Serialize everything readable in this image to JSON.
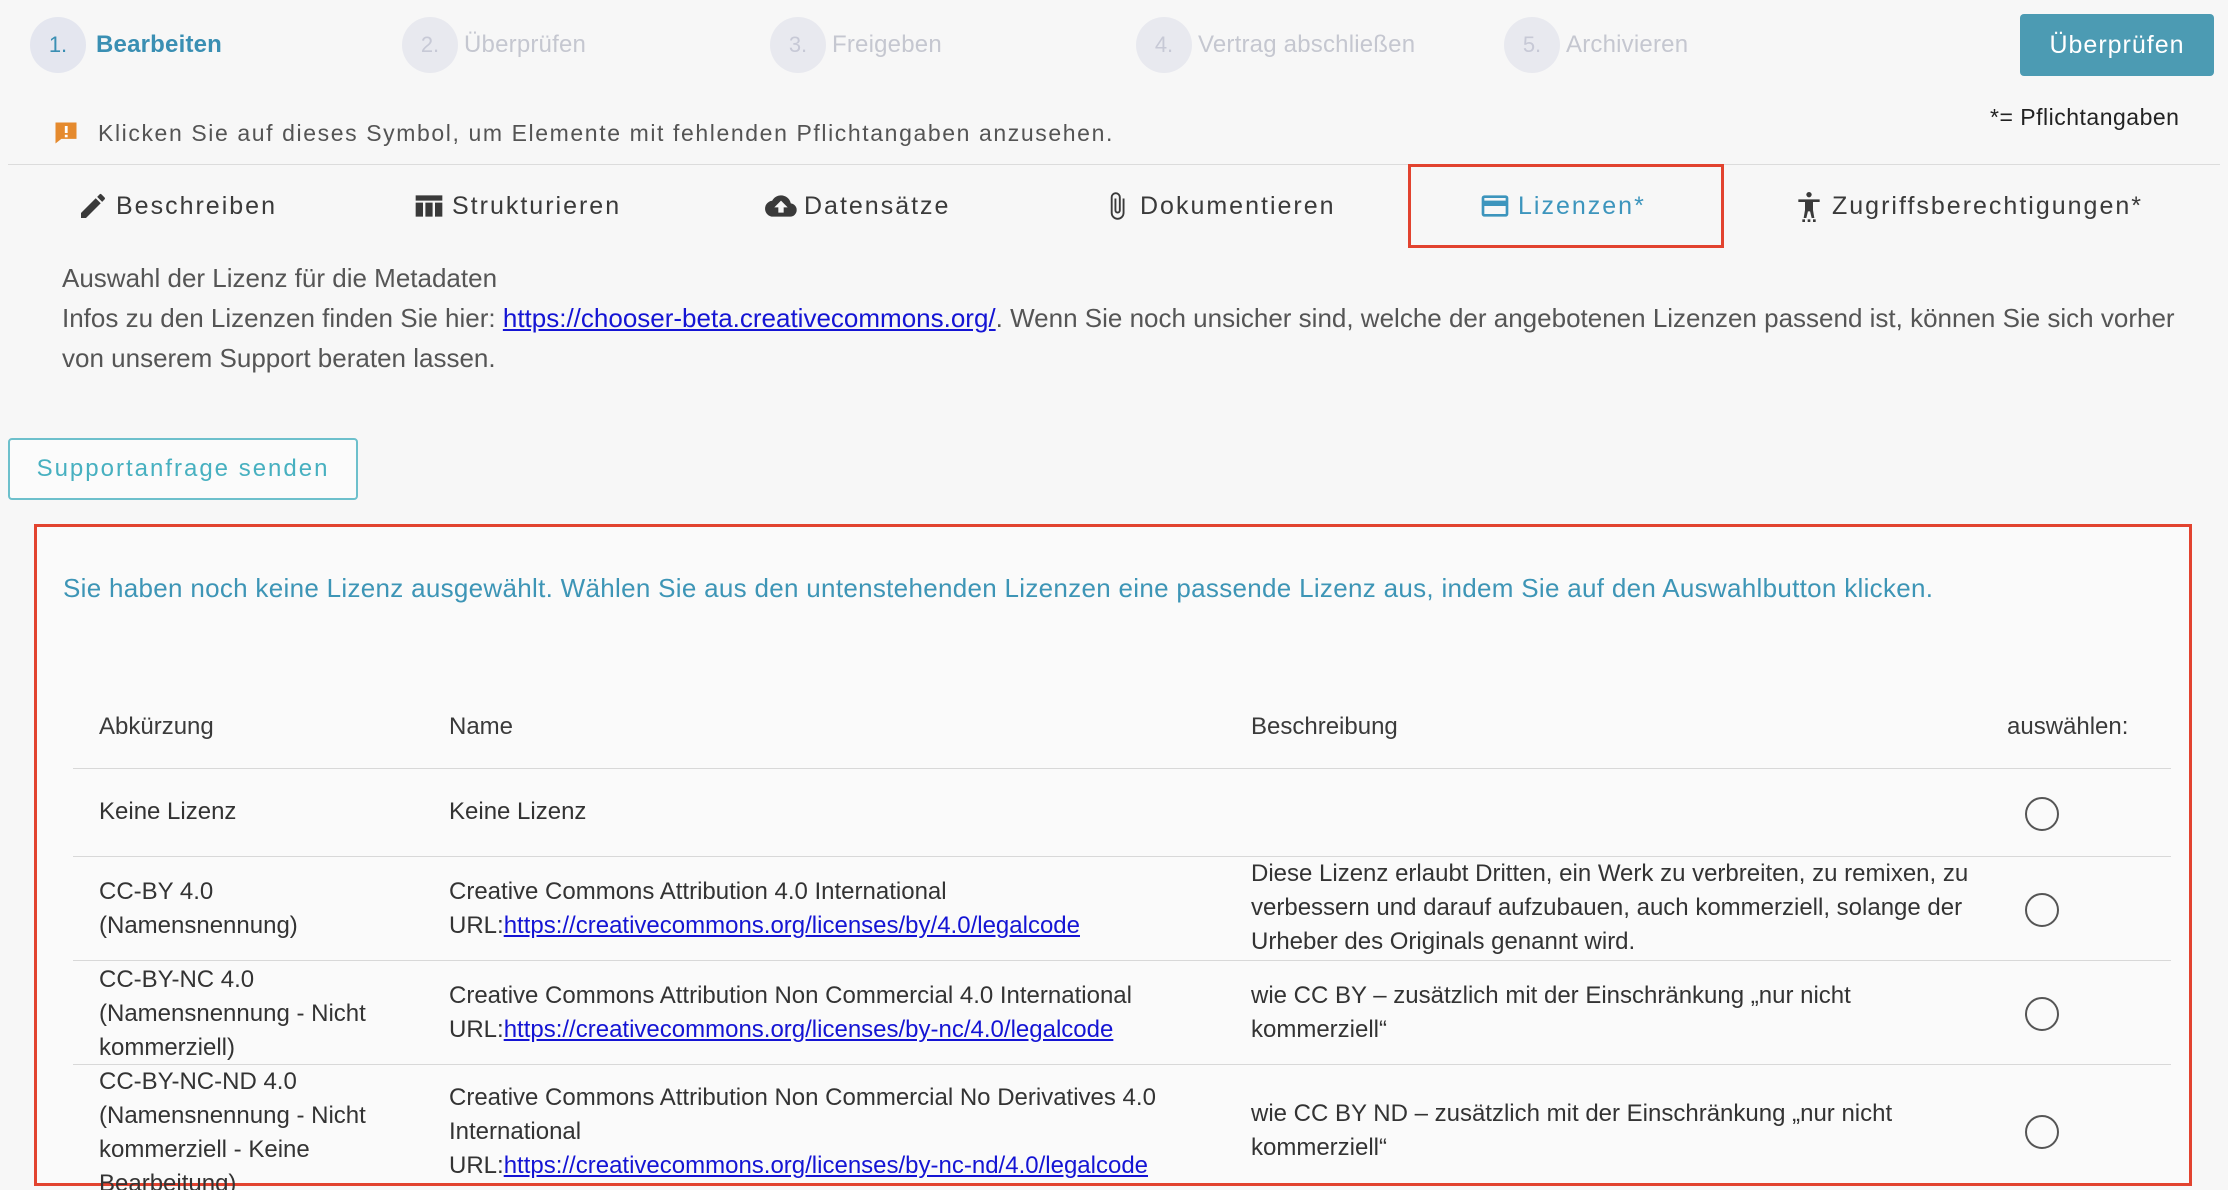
{
  "stepper": {
    "steps": [
      {
        "number": "1.",
        "label": "Bearbeiten"
      },
      {
        "number": "2.",
        "label": "Überprüfen"
      },
      {
        "number": "3.",
        "label": "Freigeben"
      },
      {
        "number": "4.",
        "label": "Vertrag abschließen"
      },
      {
        "number": "5.",
        "label": "Archivieren"
      }
    ],
    "action_label": "Überprüfen"
  },
  "hint": {
    "text": "Klicken Sie auf dieses Symbol, um Elemente mit fehlenden Pflichtangaben anzusehen.",
    "icon": "warning-bubble-icon",
    "icon_color": "#e58a2e"
  },
  "required_note": "*= Pflichtangaben",
  "tabs": [
    {
      "label": "Beschreiben",
      "icon": "pencil-icon"
    },
    {
      "label": "Strukturieren",
      "icon": "table-icon"
    },
    {
      "label": "Datensätze",
      "icon": "cloud-upload-icon"
    },
    {
      "label": "Dokumentieren",
      "icon": "paperclip-icon"
    },
    {
      "label": "Lizenzen*",
      "icon": "credit-card-icon"
    },
    {
      "label": "Zugriffsberechtigungen*",
      "icon": "accessibility-icon"
    }
  ],
  "intro": {
    "line1": "Auswahl der Lizenz für die Metadaten",
    "line2_prefix": "Infos zu den Lizenzen finden Sie hier: ",
    "link": "https://chooser-beta.creativecommons.org/",
    "line2_suffix": ". Wenn Sie noch unsicher sind, welche der angebotenen Lizenzen passend ist, können Sie sich vorher von unserem Support beraten lassen."
  },
  "support_button": "Supportanfrage senden",
  "license_panel": {
    "message": "Sie haben noch keine Lizenz ausgewählt. Wählen Sie aus den untenstehenden Lizenzen eine passende Lizenz aus, indem Sie auf den Auswahlbutton klicken.",
    "columns": [
      "Abkürzung",
      "Name",
      "Beschreibung",
      "auswählen:"
    ],
    "rows": [
      {
        "abbr": [
          "Keine Lizenz"
        ],
        "name": "Keine Lizenz",
        "url_prefix": "",
        "url": "",
        "description": ""
      },
      {
        "abbr": [
          "CC-BY 4.0",
          "(Namensnennung)"
        ],
        "name": "Creative Commons Attribution 4.0 International",
        "url_prefix": "URL:",
        "url": "https://creativecommons.org/licenses/by/4.0/legalcode",
        "description": "Diese Lizenz erlaubt Dritten, ein Werk zu verbreiten, zu remixen, zu verbessern und darauf aufzubauen, auch kommerziell, solange der Urheber des Originals genannt wird."
      },
      {
        "abbr": [
          "CC-BY-NC 4.0",
          "(Namensnennung - Nicht",
          "kommerziell)"
        ],
        "name": "Creative Commons Attribution Non Commercial 4.0 International",
        "url_prefix": "URL:",
        "url": "https://creativecommons.org/licenses/by-nc/4.0/legalcode",
        "description": "wie CC BY – zusätzlich mit der Einschränkung „nur nicht kommerziell“"
      },
      {
        "abbr": [
          "CC-BY-NC-ND 4.0",
          "(Namensnennung - Nicht",
          "kommerziell - Keine",
          "Bearbeitung)"
        ],
        "name": "Creative Commons Attribution Non Commercial No Derivatives 4.0 International",
        "url_prefix": "URL:",
        "url": "https://creativecommons.org/licenses/by-nc-nd/4.0/legalcode",
        "description": "wie CC BY ND – zusätzlich mit der Einschränkung „nur nicht kommerziell“"
      }
    ]
  },
  "colors": {
    "accent": "#3d95bd",
    "primary_button": "#4c9bb3",
    "highlight_border": "#e2432f",
    "link": "#1414d4"
  }
}
